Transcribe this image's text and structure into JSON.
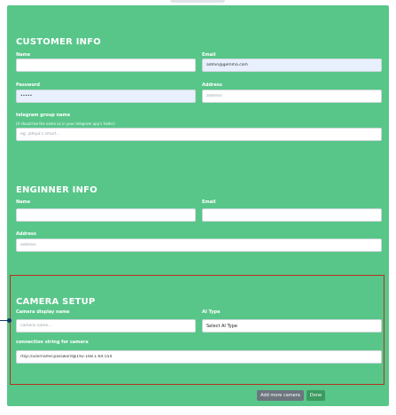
{
  "customer": {
    "title": "CUSTOMER INFO",
    "name_label": "Name",
    "name_value": "",
    "email_label": "Email",
    "email_value": "admin@gemma.com",
    "password_label": "Password",
    "password_value": "•••••",
    "address_label": "Address",
    "address_placeholder": "address",
    "telegram_label": "telegram group name",
    "telegram_hint": "(it should be the same as in your telegram app's folder)",
    "telegram_placeholder": "eg: jafeya's smart..."
  },
  "engineer": {
    "title": "ENGINNER INFO",
    "name_label": "Name",
    "email_label": "Email",
    "address_label": "Address",
    "address_placeholder": "address"
  },
  "camera": {
    "title": "CAMERA SETUP",
    "display_name_label": "Camera display name",
    "display_name_placeholder": "camera name...",
    "ai_type_label": "AI Type",
    "ai_type_selected": "Select AI Type",
    "connection_label": "connection string for camera",
    "connection_value": "rtsp://username:password@192.168.1.64:554"
  },
  "actions": {
    "add_camera_label": "Add more camera",
    "done_label": "Done"
  },
  "colors": {
    "panel": "#58c689",
    "camera_border": "#b5311f",
    "add_button": "#6c757d",
    "done_button": "#3d9a5f"
  }
}
